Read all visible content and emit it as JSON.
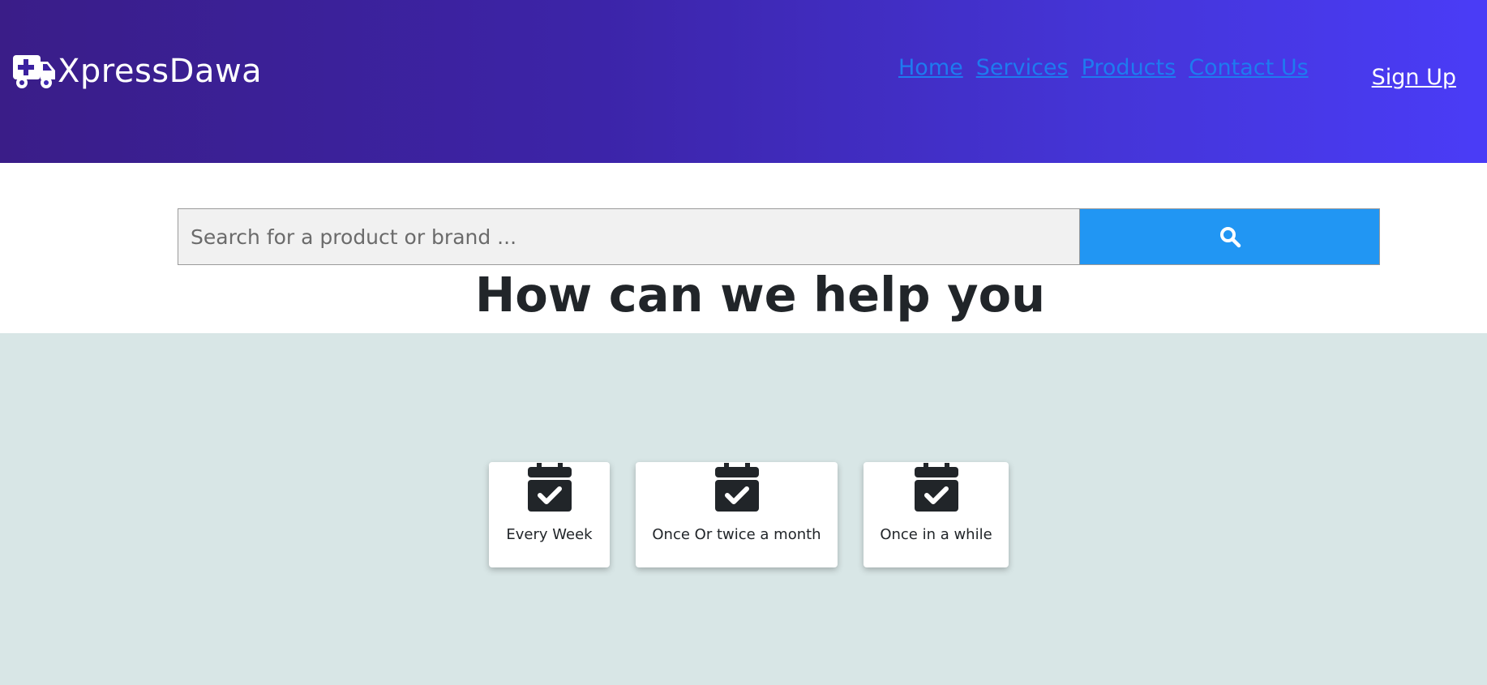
{
  "brand": {
    "name": "XpressDawa",
    "icon": "ambulance-icon"
  },
  "nav": {
    "items": [
      {
        "label": "Home"
      },
      {
        "label": "Services"
      },
      {
        "label": "Products"
      },
      {
        "label": "Contact Us"
      }
    ],
    "signup_label": "Sign Up"
  },
  "search": {
    "placeholder": "Search for a product or brand ...",
    "value": "",
    "button_icon": "search-icon"
  },
  "headline": "How can we help you",
  "frequency_options": [
    {
      "label": "Every Week",
      "icon": "calendar-check-icon"
    },
    {
      "label": "Once Or twice a month",
      "icon": "calendar-check-icon"
    },
    {
      "label": "Once in a while",
      "icon": "calendar-check-icon"
    }
  ],
  "colors": {
    "header_gradient_start": "#3a1d88",
    "header_gradient_end": "#4a3cf7",
    "nav_link": "#1e7bf0",
    "search_button": "#2196f3",
    "lower_background": "#d8e6e6"
  }
}
